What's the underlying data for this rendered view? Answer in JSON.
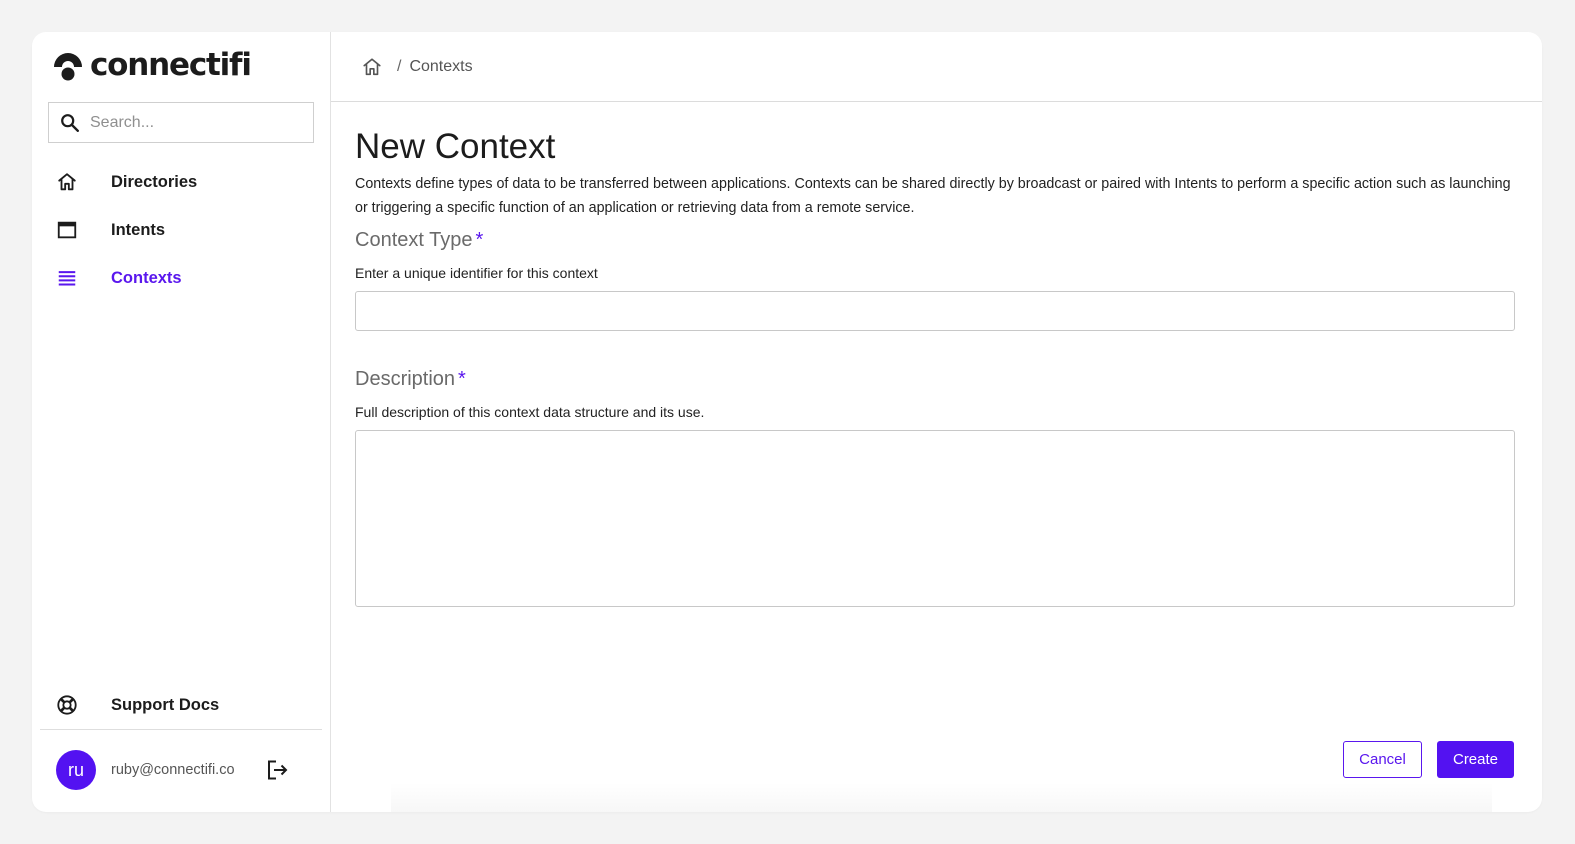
{
  "brand": {
    "name": "connectifi",
    "logo_icon": "connectifi-logo-icon",
    "accent_color": "#5312f1"
  },
  "sidebar": {
    "search": {
      "placeholder": "Search...",
      "value": "",
      "icon": "search-icon"
    },
    "items": [
      {
        "label": "Directories",
        "icon": "home-icon",
        "active": false
      },
      {
        "label": "Intents",
        "icon": "window-icon",
        "active": false
      },
      {
        "label": "Contexts",
        "icon": "list-icon",
        "active": true
      }
    ],
    "support": {
      "label": "Support Docs",
      "icon": "lifebuoy-icon"
    },
    "user": {
      "initials": "ru",
      "email": "ruby@connectifi.co",
      "logout_icon": "logout-icon"
    }
  },
  "breadcrumb": {
    "home_icon": "home-icon",
    "separator": "/",
    "current": "Contexts"
  },
  "page": {
    "title": "New Context",
    "description": "Contexts define types of data to be transferred between applications. Contexts can be shared directly by broadcast or paired with Intents to perform a specific action such as launching or triggering a specific function of an application or retrieving data from a remote service."
  },
  "form": {
    "context_type": {
      "label": "Context Type",
      "required_marker": "*",
      "help": "Enter a unique identifier for this context",
      "value": ""
    },
    "description": {
      "label": "Description",
      "required_marker": "*",
      "help": "Full description of this context data structure and its use.",
      "value": ""
    },
    "actions": {
      "cancel_label": "Cancel",
      "create_label": "Create"
    }
  }
}
